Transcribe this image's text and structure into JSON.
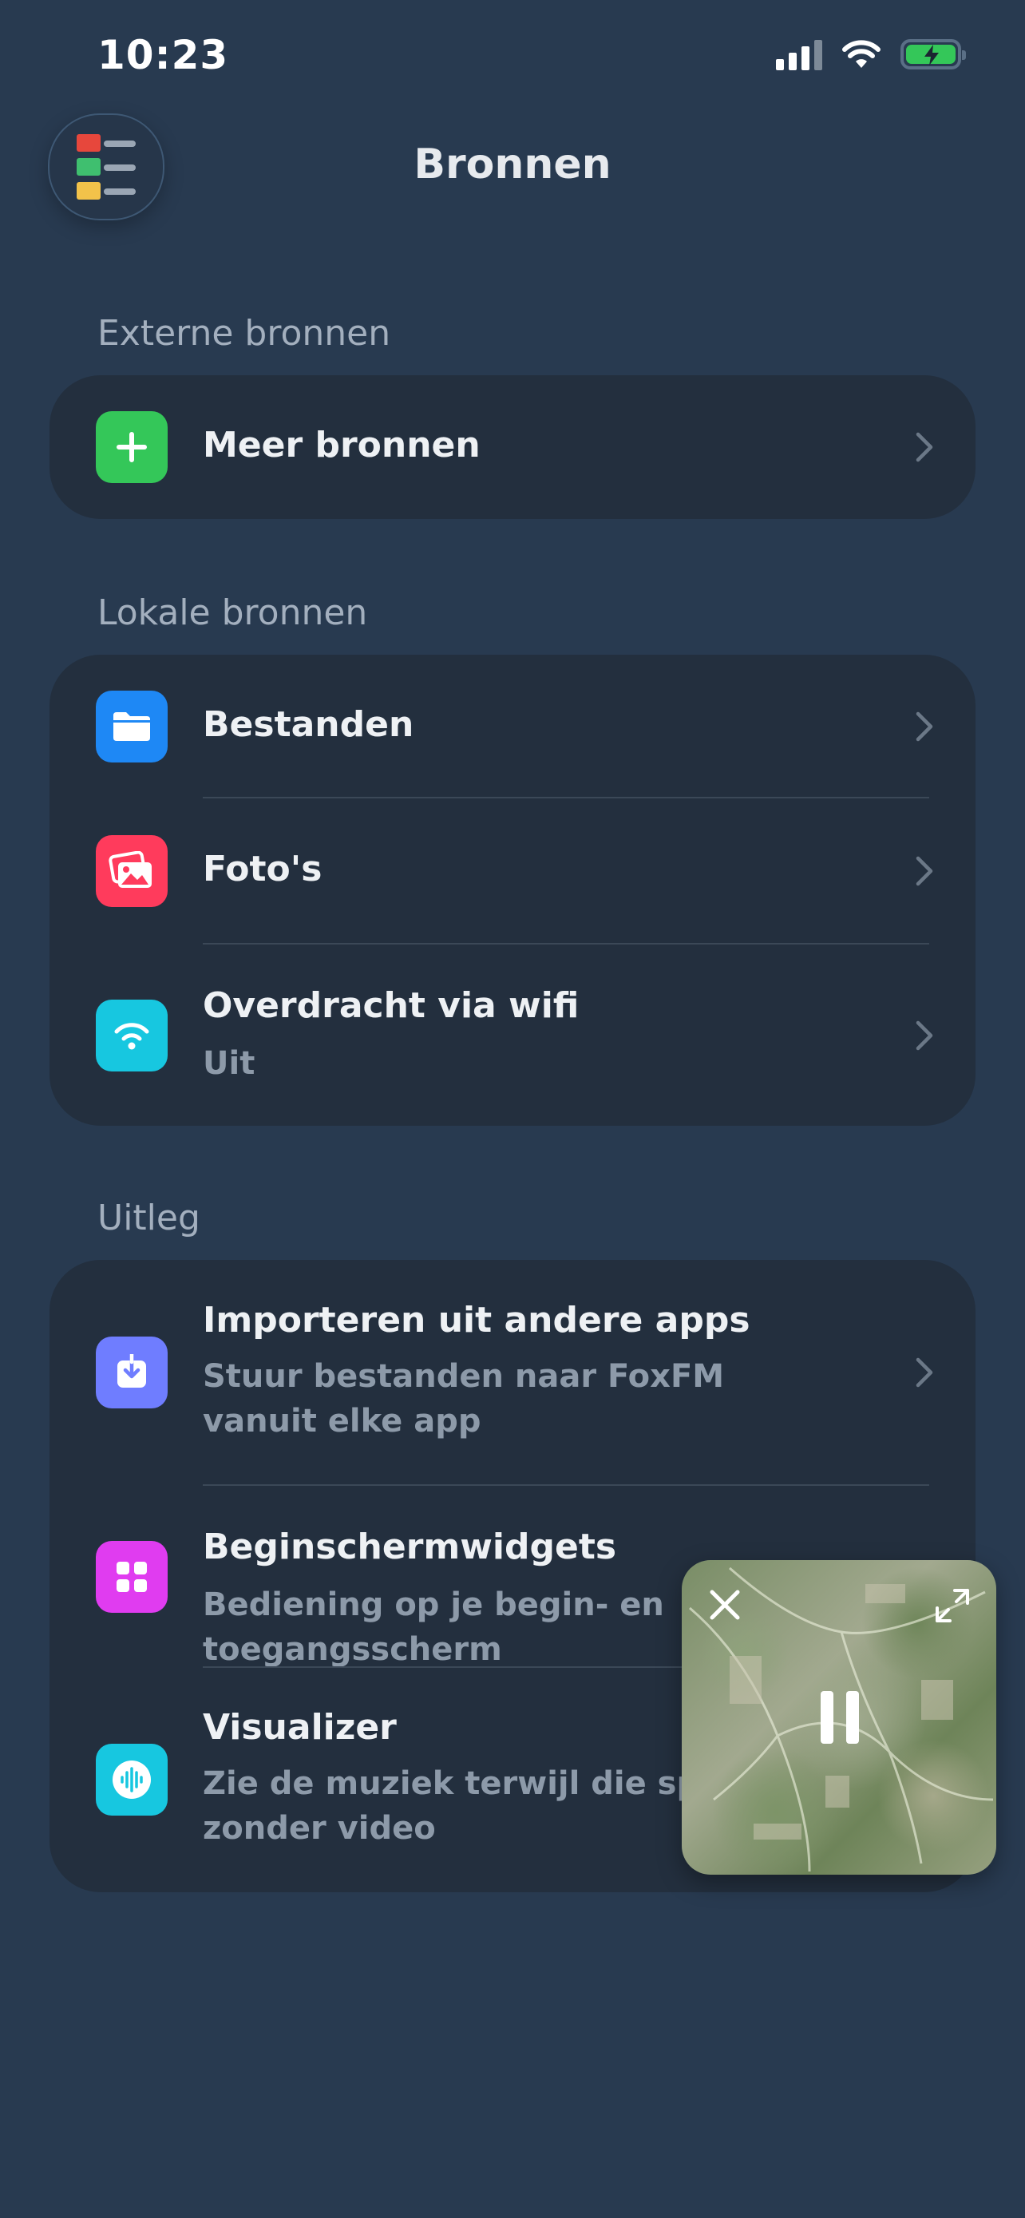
{
  "status_bar": {
    "time": "10:23"
  },
  "header": {
    "title": "Bronnen",
    "menu_icon": "colored-list-icon"
  },
  "sections": {
    "external": {
      "header": "Externe bronnen",
      "items": [
        {
          "title": "Meer bronnen",
          "icon": "plus-icon",
          "icon_color": "#34c759"
        }
      ]
    },
    "local": {
      "header": "Lokale bronnen",
      "items": [
        {
          "title": "Bestanden",
          "icon": "folder-icon",
          "icon_color": "#1e88f5"
        },
        {
          "title": "Foto's",
          "icon": "photos-icon",
          "icon_color": "#ff3b5c"
        },
        {
          "title": "Overdracht via wifi",
          "subtitle": "Uit",
          "icon": "wifi-icon",
          "icon_color": "#17c7e0"
        }
      ]
    },
    "explanation": {
      "header": "Uitleg",
      "items": [
        {
          "title": "Importeren uit andere apps",
          "subtitle": "Stuur bestanden naar FoxFM vanuit elke app",
          "icon": "import-icon",
          "icon_color": "#6f7dff"
        },
        {
          "title": "Beginschermwidgets",
          "subtitle": "Bediening op je begin- en toegangsscherm",
          "icon": "widgets-icon",
          "icon_color": "#e03cf0"
        },
        {
          "title": "Visualizer",
          "subtitle": "Zie de muziek terwijl die speelt zonder video",
          "icon": "waveform-icon",
          "icon_color": "#17c7e0"
        }
      ]
    }
  },
  "pip_player": {
    "state": "playing",
    "controls": [
      "close-icon",
      "expand-icon",
      "pause-icon"
    ]
  }
}
